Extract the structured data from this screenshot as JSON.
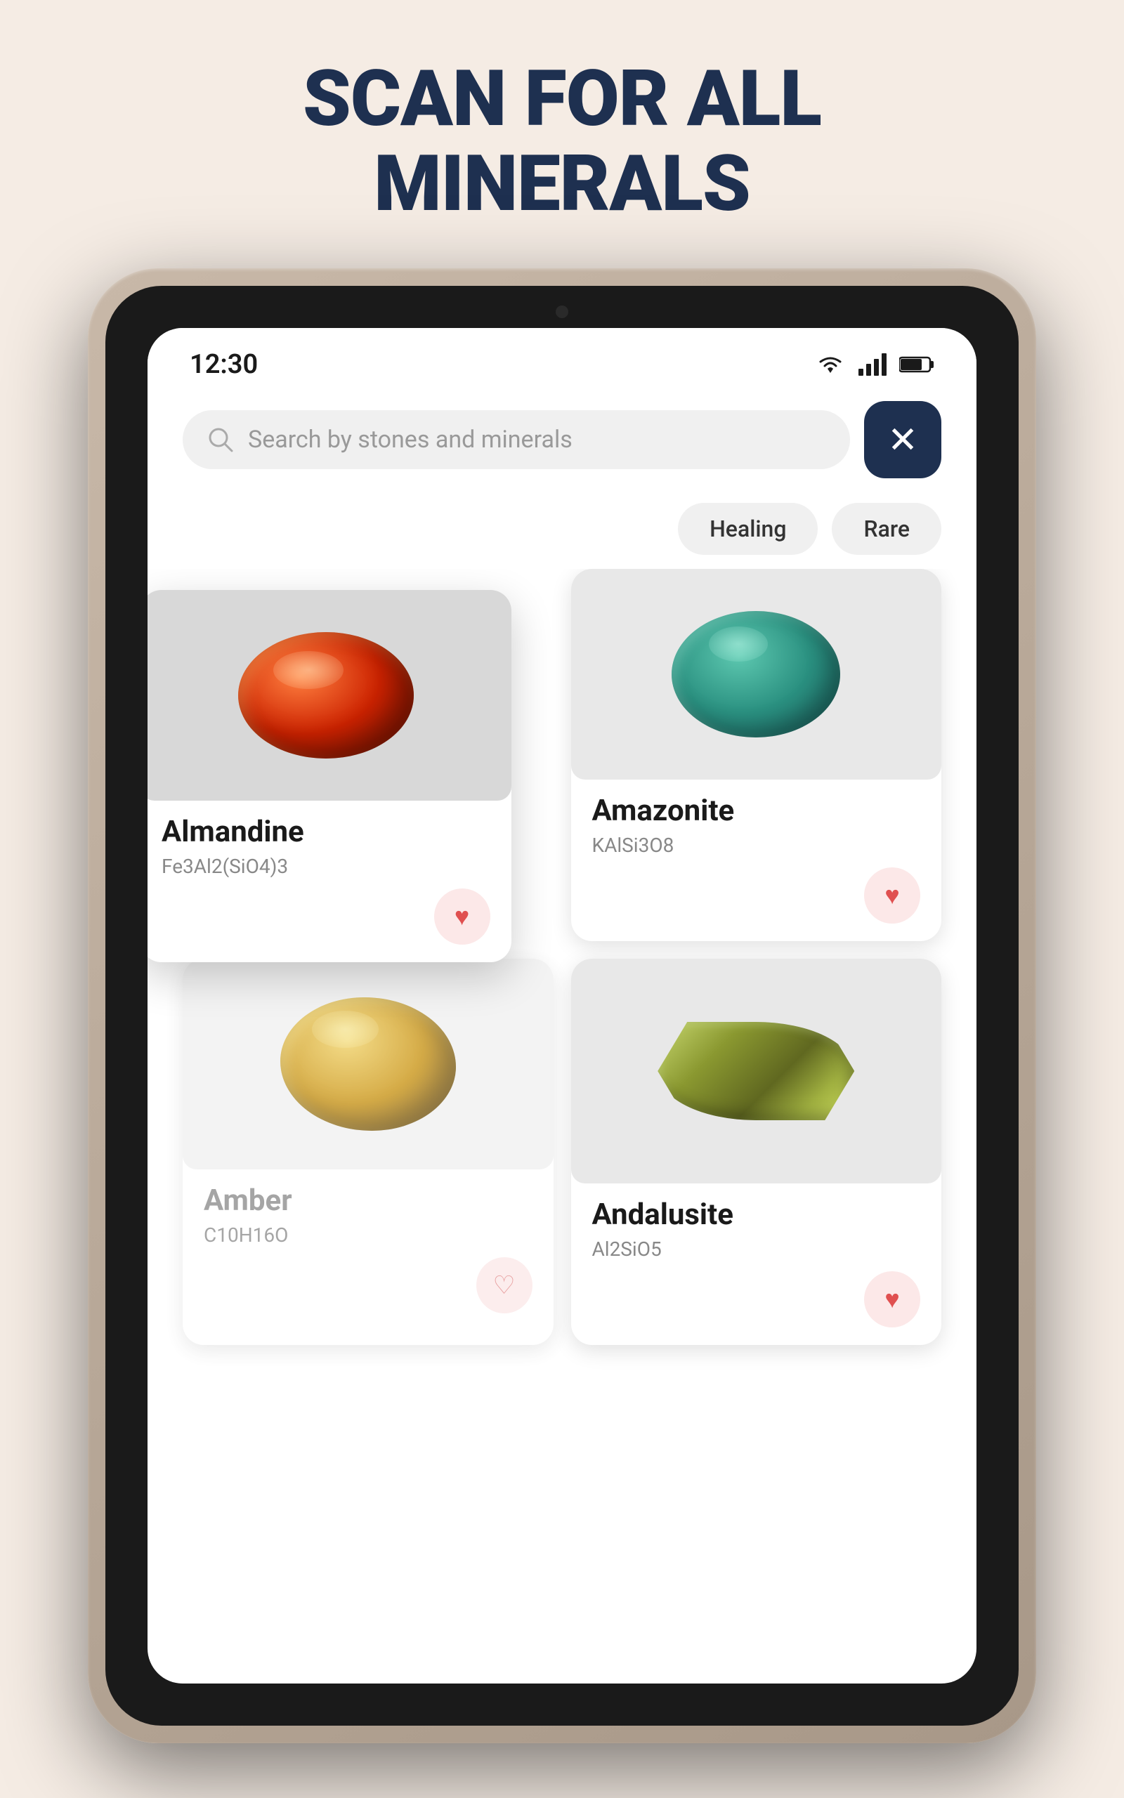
{
  "page": {
    "title_line1": "SCAN FOR ALL",
    "title_line2": "MINERALS"
  },
  "status_bar": {
    "time": "12:30",
    "wifi_icon": "wifi-icon",
    "signal_icon": "signal-icon",
    "battery_icon": "battery-icon"
  },
  "search": {
    "placeholder": "Search by stones and minerals",
    "close_label": "✕"
  },
  "filters": [
    {
      "id": "healing",
      "label": "Healing"
    },
    {
      "id": "rare",
      "label": "Rare"
    }
  ],
  "minerals": [
    {
      "id": "almandine",
      "name": "Almandine",
      "formula": "Fe3Al2(SiO4)3",
      "favorited": true,
      "featured": true
    },
    {
      "id": "amazonite",
      "name": "Amazonite",
      "formula": "KAlSi3O8",
      "favorited": true,
      "featured": false
    },
    {
      "id": "amber",
      "name": "Amber",
      "formula": "C10H16O",
      "favorited": false,
      "featured": false,
      "dimmed": true
    },
    {
      "id": "andalusite",
      "name": "Andalusite",
      "formula": "Al2SiO5",
      "favorited": true,
      "featured": false
    }
  ],
  "colors": {
    "title": "#1e3050",
    "background": "#f5ece4",
    "close_btn_bg": "#1e3050",
    "heart_bg": "#fce8e8",
    "heart_filled": "#e05050",
    "heart_outline": "#e08080",
    "chip_bg": "#f0f0f0"
  }
}
